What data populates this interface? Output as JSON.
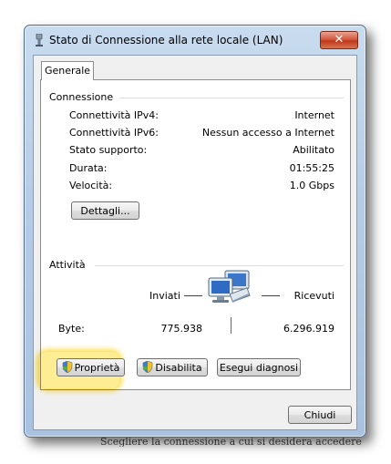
{
  "window": {
    "title": "Stato di Connessione alla rete locale (LAN)",
    "close_label": "✕"
  },
  "tabs": [
    {
      "label": "Generale",
      "selected": true
    }
  ],
  "connection": {
    "title": "Connessione",
    "rows": [
      {
        "label": "Connettività IPv4:",
        "value": "Internet"
      },
      {
        "label": "Connettività IPv6:",
        "value": "Nessun accesso a Internet"
      },
      {
        "label": "Stato supporto:",
        "value": "Abilitato"
      },
      {
        "label": "Durata:",
        "value": "01:55:25"
      },
      {
        "label": "Velocità:",
        "value": "1.0 Gbps"
      }
    ],
    "details_button": "Dettagli..."
  },
  "activity": {
    "title": "Attività",
    "sent_label": "Inviati",
    "received_label": "Ricevuti",
    "bytes_label": "Byte:",
    "bytes_sent": "775.938",
    "bytes_received": "6.296.919",
    "icon": "network-computers-icon"
  },
  "buttons": {
    "properties": "Proprietà",
    "disable": "Disabilita",
    "diagnose": "Esegui diagnosi",
    "close": "Chiudi"
  },
  "annotation": {
    "arrow_color": "#f39a1e",
    "highlight_color": "#ffd83c"
  }
}
